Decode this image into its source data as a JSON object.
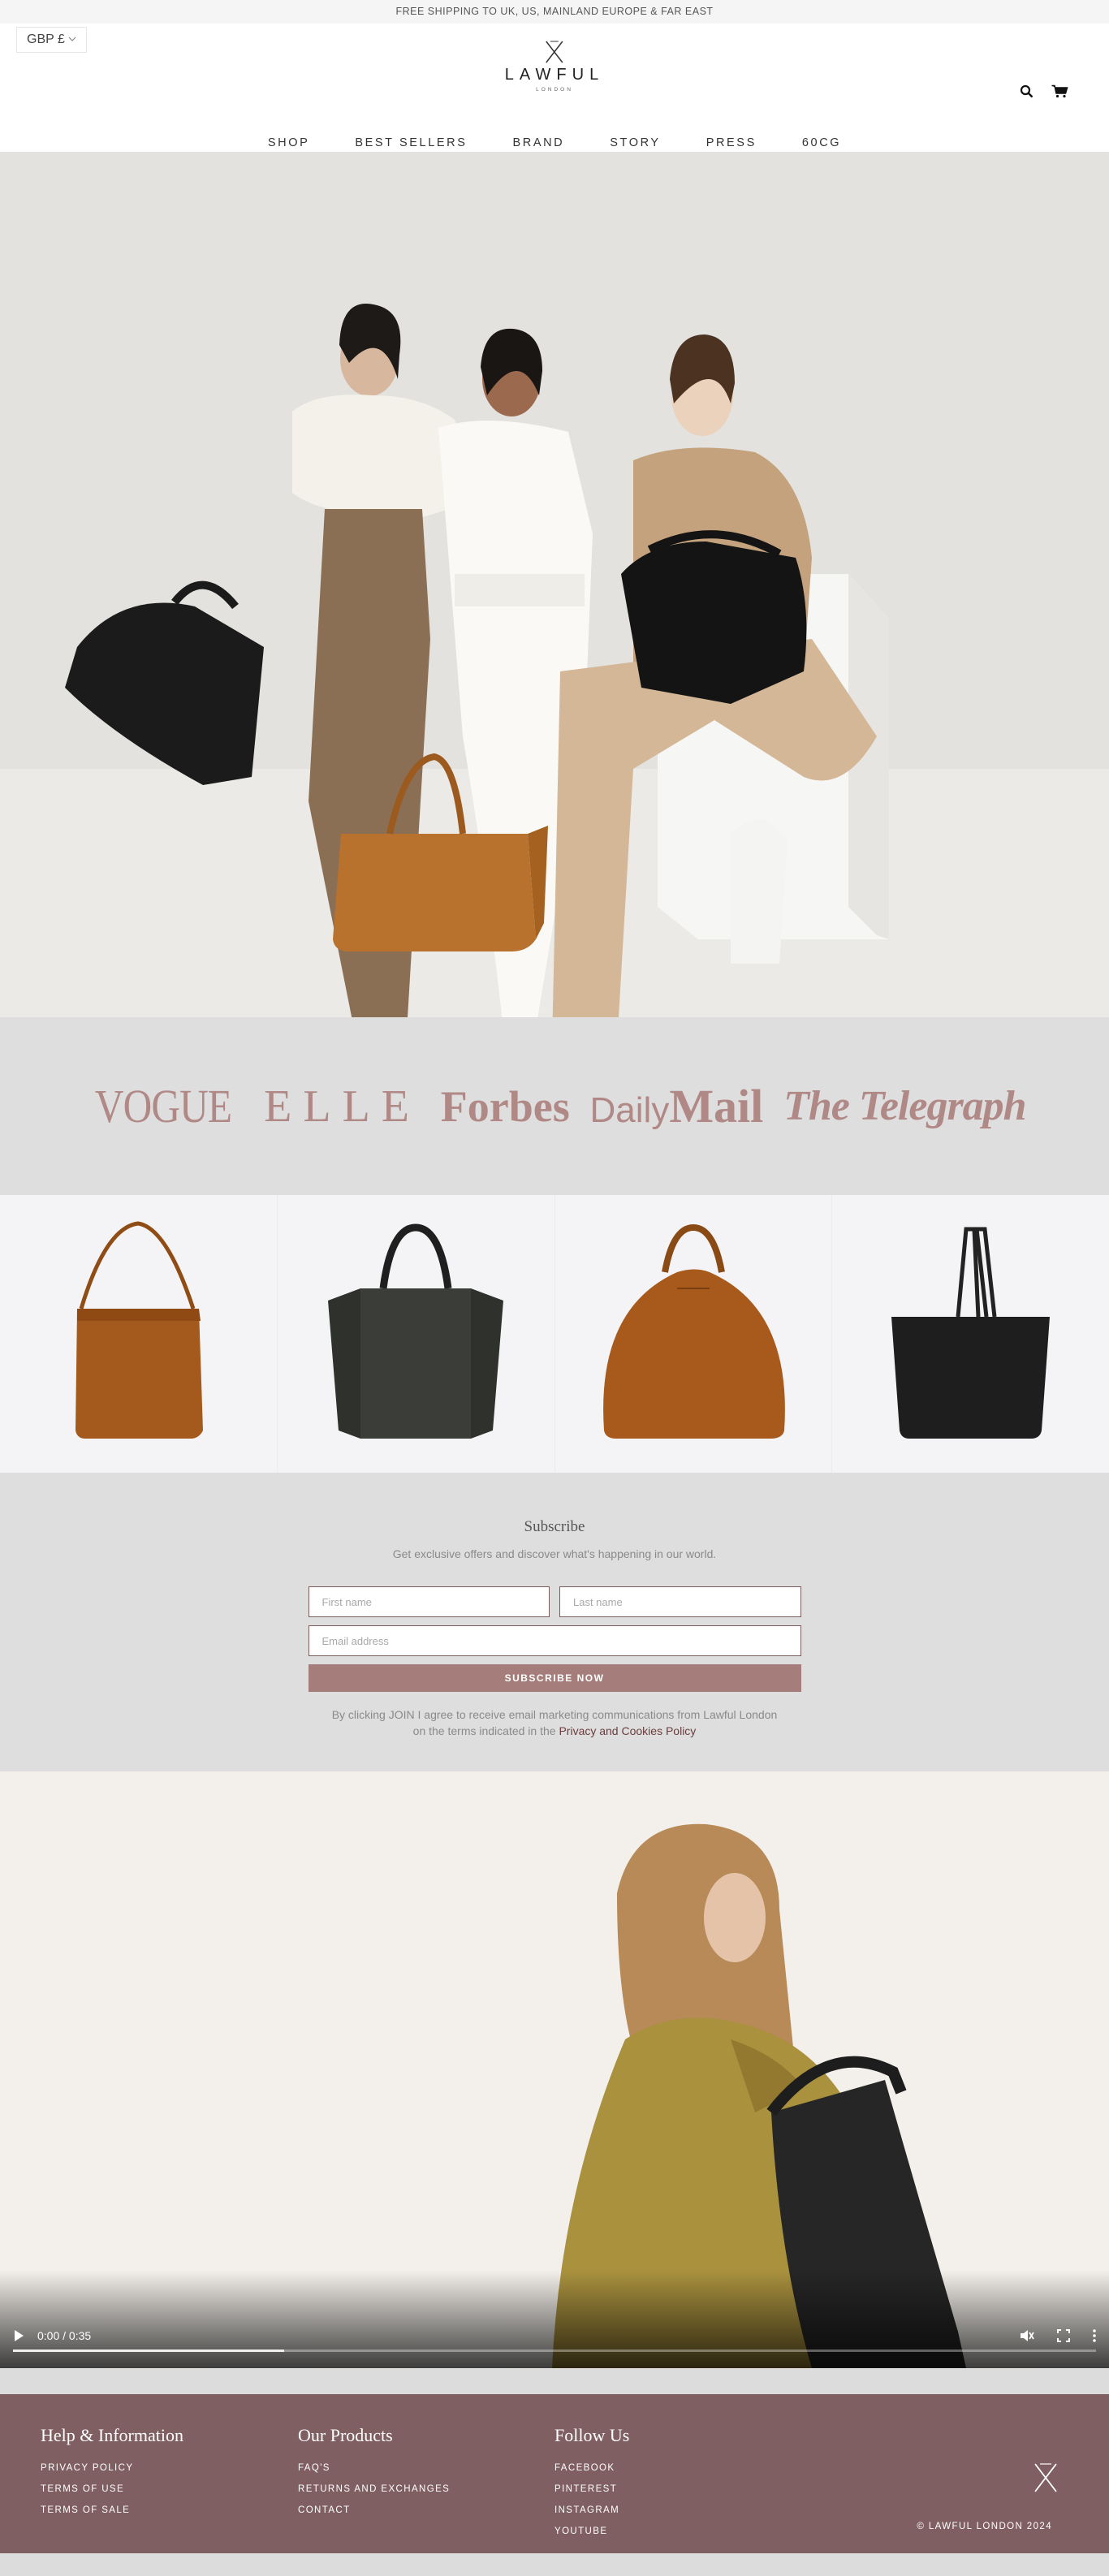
{
  "announcement": "FREE SHIPPING TO UK, US, MAINLAND EUROPE & FAR EAST",
  "header": {
    "currency": "GBP £",
    "brand": "LAWFUL",
    "brand_sub": "LONDON",
    "nav": [
      "SHOP",
      "BEST SELLERS",
      "BRAND",
      "STORY",
      "PRESS",
      "60CG"
    ]
  },
  "press": [
    "VOGUE",
    "ELLE",
    "Forbes",
    "Daily",
    "Mail",
    "The Telegraph"
  ],
  "products": [
    "tan-hobo-bag",
    "black-tote-bag",
    "tan-dome-bag",
    "black-shopper-bag"
  ],
  "subscribe": {
    "title": "Subscribe",
    "lead": "Get exclusive offers and discover what's happening in our world.",
    "first_name_placeholder": "First name",
    "last_name_placeholder": "Last name",
    "email_placeholder": "Email address",
    "button": "SUBSCRIBE NOW",
    "disclaimer": "By clicking JOIN I agree to receive email marketing communications from Lawful London on the terms indicated in the",
    "policy_link": "Privacy and Cookies Policy"
  },
  "video": {
    "time": "0:00 / 0:35",
    "progress": 0.25
  },
  "footer": {
    "columns": [
      {
        "title": "Help & Information",
        "links": [
          "PRIVACY POLICY",
          "TERMS OF USE",
          "TERMS OF SALE"
        ]
      },
      {
        "title": "Our Products",
        "links": [
          "FAQ'S",
          "RETURNS AND EXCHANGES",
          "CONTACT"
        ]
      },
      {
        "title": "Follow Us",
        "links": [
          "FACEBOOK",
          "PINTEREST",
          "INSTAGRAM",
          "YOUTUBE"
        ]
      }
    ],
    "copyright": "© LAWFUL LONDON 2024"
  },
  "colors": {
    "accent": "#a57e7b",
    "footer": "#805f62",
    "press": "#b08987",
    "band": "#dedede"
  },
  "icons": [
    "search-icon",
    "cart-icon",
    "chevron-down-icon",
    "play-icon",
    "volume-muted-icon",
    "fullscreen-icon",
    "more-options-icon",
    "brand-logo-icon"
  ]
}
